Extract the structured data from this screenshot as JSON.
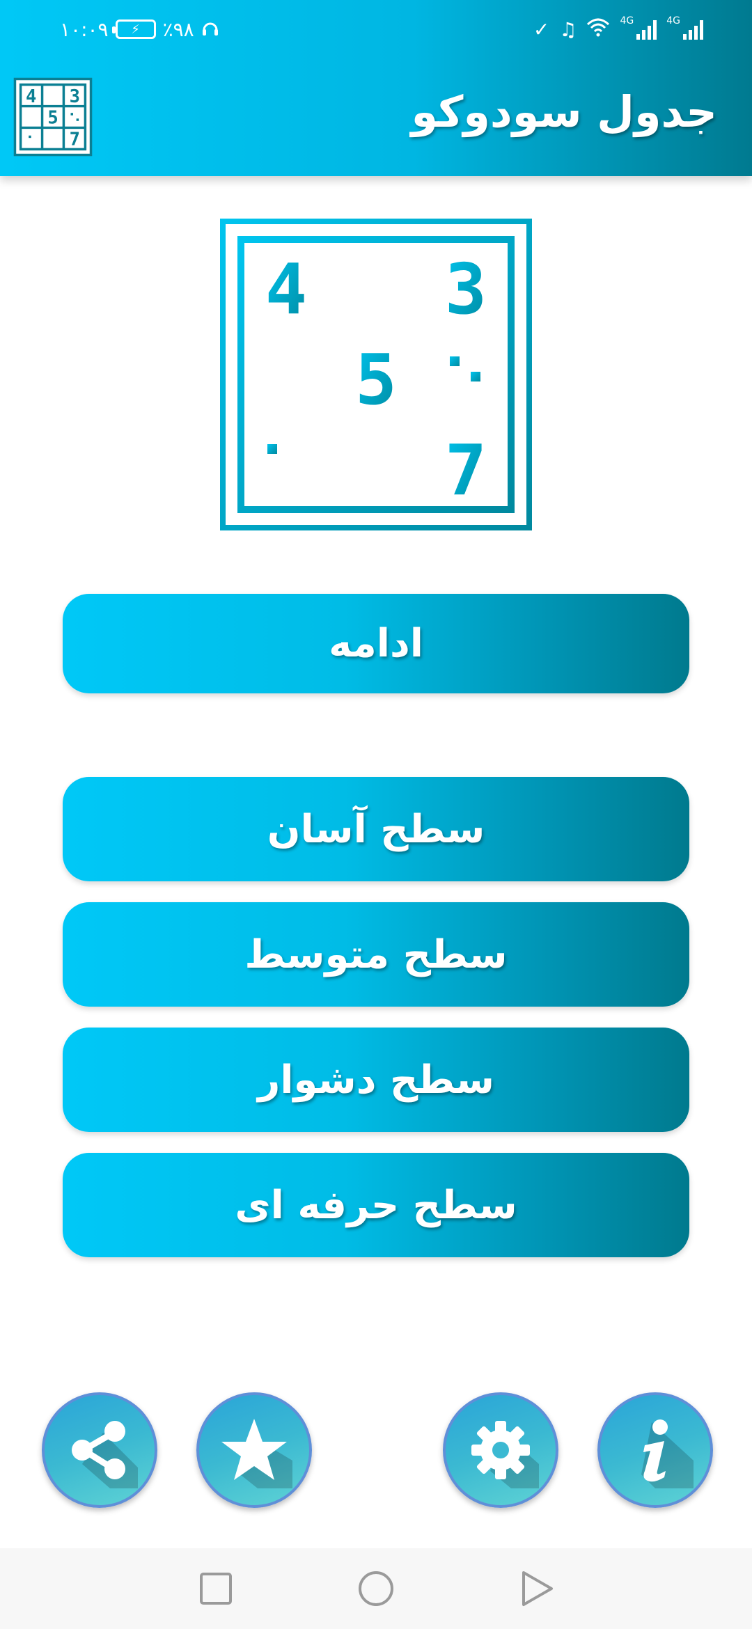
{
  "status_bar": {
    "time": "۱۰:۰۹",
    "battery": "٪۹۸",
    "network_label": "4G"
  },
  "header": {
    "title": "جدول سودوکو"
  },
  "logo": {
    "digits": [
      "4",
      "3",
      "5",
      "7"
    ]
  },
  "buttons": {
    "continue": "ادامه",
    "easy": "سطح آسان",
    "medium": "سطح متوسط",
    "hard": "سطح دشوار",
    "pro": "سطح حرفه ای"
  },
  "actions": {
    "icons": [
      "share-icon",
      "star-icon",
      "gear-icon",
      "info-icon"
    ]
  },
  "nav": {
    "icons": [
      "recent-apps-icon",
      "home-icon",
      "back-icon"
    ]
  },
  "colors": {
    "accent_start": "#00c8f6",
    "accent_end": "#007a90",
    "logo": "#0aaed0"
  }
}
